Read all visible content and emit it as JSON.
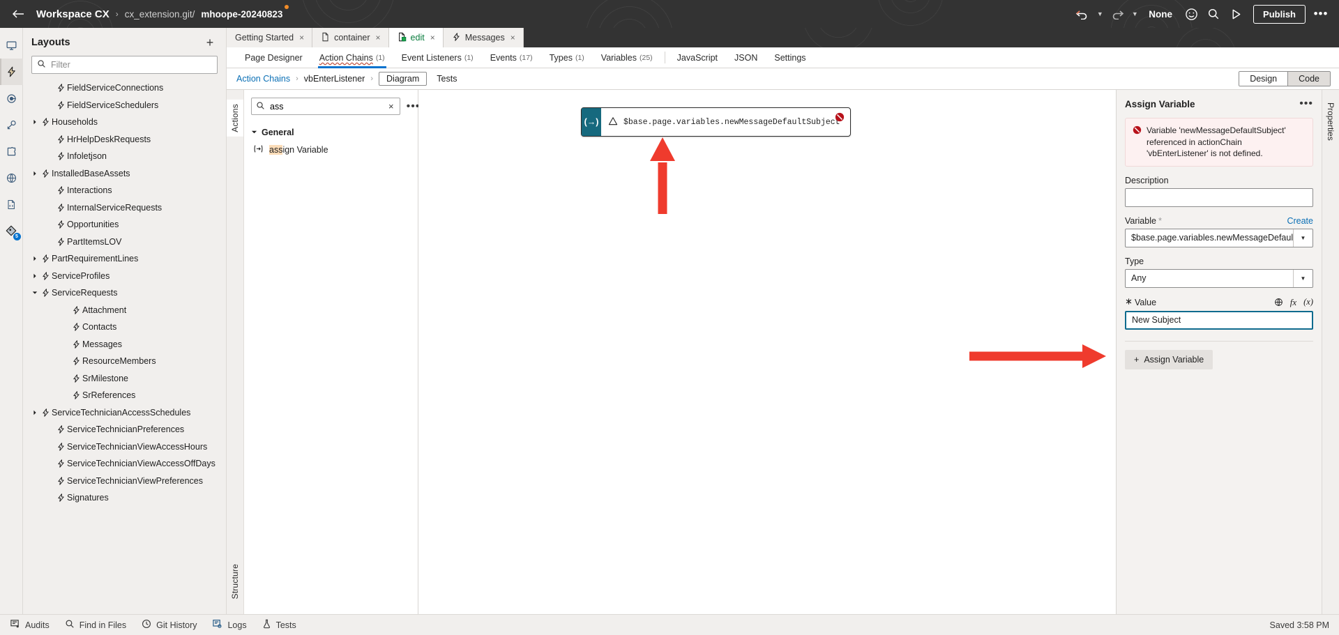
{
  "header": {
    "back_label": "Back",
    "workspace": "Workspace CX",
    "separator": "›",
    "repo": "cx_extension.git/",
    "branch": "mhoope-20240823",
    "undo_label": "Undo",
    "redo_label": "Redo",
    "env_label": "None",
    "publish_label": "Publish",
    "more_label": "More options"
  },
  "rail": {
    "items": [
      {
        "name": "monitor-icon",
        "label": "Preview"
      },
      {
        "name": "lightning-icon",
        "label": "Layouts"
      },
      {
        "name": "target-icon",
        "label": "Processes"
      },
      {
        "name": "plug-icon",
        "label": "Services"
      },
      {
        "name": "puzzle-icon",
        "label": "Components"
      },
      {
        "name": "globe-icon",
        "label": "Web Apps"
      },
      {
        "name": "file-code-icon",
        "label": "Source"
      },
      {
        "name": "git-icon",
        "label": "Git",
        "badge": "5"
      }
    ],
    "selected_index": 1
  },
  "layouts": {
    "title": "Layouts",
    "add_label": "+",
    "filter_placeholder": "Filter",
    "filter_value": "",
    "items": [
      {
        "label": "FieldServiceConnections",
        "depth": 1,
        "expandable": false
      },
      {
        "label": "FieldServiceSchedulers",
        "depth": 1,
        "expandable": false
      },
      {
        "label": "Households",
        "depth": 0,
        "expandable": true,
        "expanded": false
      },
      {
        "label": "HrHelpDeskRequests",
        "depth": 1,
        "expandable": false
      },
      {
        "label": "Infoletjson",
        "depth": 1,
        "expandable": false
      },
      {
        "label": "InstalledBaseAssets",
        "depth": 0,
        "expandable": true,
        "expanded": false
      },
      {
        "label": "Interactions",
        "depth": 1,
        "expandable": false
      },
      {
        "label": "InternalServiceRequests",
        "depth": 1,
        "expandable": false
      },
      {
        "label": "Opportunities",
        "depth": 1,
        "expandable": false
      },
      {
        "label": "PartItemsLOV",
        "depth": 1,
        "expandable": false
      },
      {
        "label": "PartRequirementLines",
        "depth": 0,
        "expandable": true,
        "expanded": false
      },
      {
        "label": "ServiceProfiles",
        "depth": 0,
        "expandable": true,
        "expanded": false
      },
      {
        "label": "ServiceRequests",
        "depth": 0,
        "expandable": true,
        "expanded": true
      },
      {
        "label": "Attachment",
        "depth": 2,
        "expandable": false
      },
      {
        "label": "Contacts",
        "depth": 2,
        "expandable": false
      },
      {
        "label": "Messages",
        "depth": 2,
        "expandable": false
      },
      {
        "label": "ResourceMembers",
        "depth": 2,
        "expandable": false
      },
      {
        "label": "SrMilestone",
        "depth": 2,
        "expandable": false
      },
      {
        "label": "SrReferences",
        "depth": 2,
        "expandable": false
      },
      {
        "label": "ServiceTechnicianAccessSchedules",
        "depth": 0,
        "expandable": true,
        "expanded": false
      },
      {
        "label": "ServiceTechnicianPreferences",
        "depth": 1,
        "expandable": false
      },
      {
        "label": "ServiceTechnicianViewAccessHours",
        "depth": 1,
        "expandable": false
      },
      {
        "label": "ServiceTechnicianViewAccessOffDays",
        "depth": 1,
        "expandable": false
      },
      {
        "label": "ServiceTechnicianViewPreferences",
        "depth": 1,
        "expandable": false
      },
      {
        "label": "Signatures",
        "depth": 1,
        "expandable": false
      }
    ]
  },
  "editor": {
    "tabs": [
      {
        "label": "Getting Started",
        "icon": "none",
        "active": false
      },
      {
        "label": "container",
        "icon": "file-icon",
        "active": false
      },
      {
        "label": "edit",
        "icon": "page-edit-icon",
        "active": true
      },
      {
        "label": "Messages",
        "icon": "lightning-icon",
        "active": false
      }
    ],
    "close_label": "×",
    "subtabs": [
      {
        "label": "Page Designer",
        "count": "",
        "active": false
      },
      {
        "label": "Action Chains",
        "count": "(1)",
        "active": true
      },
      {
        "label": "Event Listeners",
        "count": "(1)",
        "active": false
      },
      {
        "label": "Events",
        "count": "(17)",
        "active": false
      },
      {
        "label": "Types",
        "count": "(1)",
        "active": false
      },
      {
        "label": "Variables",
        "count": "(25)",
        "active": false
      },
      {
        "label": "JavaScript",
        "count": "",
        "active": false,
        "divider_before": true
      },
      {
        "label": "JSON",
        "count": "",
        "active": false
      },
      {
        "label": "Settings",
        "count": "",
        "active": false
      }
    ],
    "breadcrumb": {
      "root": "Action Chains",
      "sep": "›",
      "chain": "vbEnterListener",
      "view_diagram": "Diagram",
      "view_tests": "Tests",
      "selected_view": "Diagram"
    },
    "design_code": {
      "design": "Design",
      "code": "Code",
      "selected": "Code"
    }
  },
  "palette": {
    "vtab_actions": "Actions",
    "vtab_structure": "Structure",
    "search_value": "ass",
    "search_placeholder": "Search",
    "clear_label": "×",
    "more_label": "…",
    "group_label": "General",
    "items": [
      {
        "label": "Assign Variable",
        "icon": "assign-variable-icon",
        "match": "ass",
        "rest": "ign Variable"
      }
    ]
  },
  "canvas": {
    "node": {
      "icon_glyph": "(→)",
      "code": "$base.page.variables.newMessageDefaultSubject = 'New Subject'",
      "warning_glyph": "⚠",
      "error_badge": "error-badge"
    }
  },
  "properties": {
    "title": "Assign Variable",
    "more_label": "…",
    "error_message": "Variable 'newMessageDefaultSubject' referenced in actionChain 'vbEnterListener' is not defined.",
    "description": {
      "label": "Description",
      "value": "",
      "placeholder": ""
    },
    "variable": {
      "label": "Variable",
      "required_marker": "*",
      "create_link": "Create",
      "value": "$base.page.variables.newMessageDefault"
    },
    "type": {
      "label": "Type",
      "value": "Any"
    },
    "value_field": {
      "label": "Value",
      "value": "New Subject",
      "icons": [
        "globe-icon",
        "fx-icon",
        "expression-icon"
      ],
      "fx_label": "fx",
      "expr_label": "(x)"
    },
    "assign_button": {
      "label": "Assign Variable",
      "plus": "+"
    },
    "right_rail_label": "Properties"
  },
  "status": {
    "items": [
      {
        "label": "Audits",
        "icon": "audits-icon"
      },
      {
        "label": "Find in Files",
        "icon": "search-icon"
      },
      {
        "label": "Git History",
        "icon": "clock-icon"
      },
      {
        "label": "Logs",
        "icon": "logs-icon"
      },
      {
        "label": "Tests",
        "icon": "flask-icon"
      }
    ],
    "saved": "Saved 3:58 PM"
  }
}
